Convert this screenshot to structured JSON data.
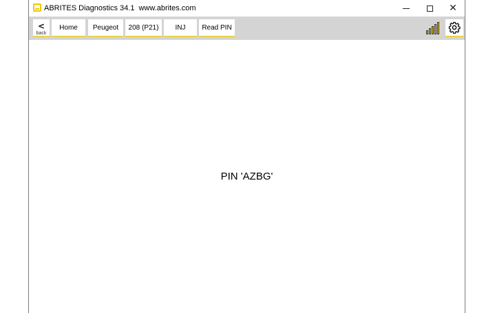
{
  "window": {
    "app_name": "ABRITES Diagnostics 34.1",
    "url": "www.abrites.com",
    "minimize_icon": "minimize-icon",
    "maximize_icon": "maximize-icon",
    "close_icon": "close-icon"
  },
  "toolbar": {
    "back_label": "back",
    "breadcrumbs": [
      {
        "label": "Home"
      },
      {
        "label": "Peugeot"
      },
      {
        "label": "208 (P21)"
      },
      {
        "label": "INJ"
      },
      {
        "label": "Read PIN"
      }
    ],
    "signal_icon": "signal-strength-icon",
    "settings_icon": "gear-icon"
  },
  "main": {
    "message": "PIN 'AZBG'"
  },
  "colors": {
    "accent": "#f5c400",
    "toolbar_bg": "#d4d4d4",
    "underline": "#e8d24a"
  }
}
